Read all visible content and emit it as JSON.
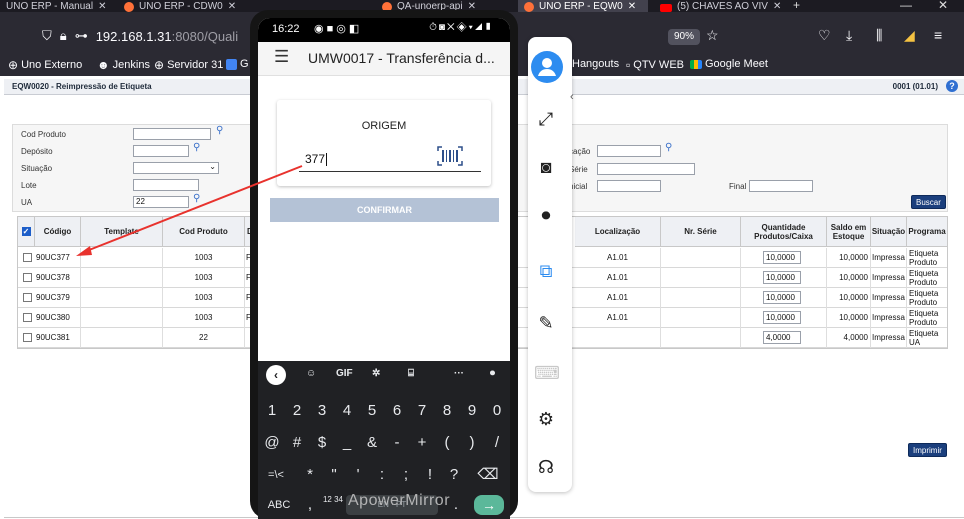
{
  "browser": {
    "tabs": [
      {
        "title": "UNO ERP - Manual ",
        "active": false
      },
      {
        "title": "UNO ERP - CDW0",
        "active": false
      },
      {
        "title": "QA-unoerp-api",
        "active": false
      },
      {
        "title": "UNO ERP - EQW0",
        "active": true
      },
      {
        "title": "(5) CHAVES AO VIV",
        "active": false
      }
    ],
    "url_host": "192.168.1.31",
    "url_rest": ":8080/Quali",
    "zoom": "90%",
    "bookmarks": [
      {
        "label": "Uno Externo",
        "icon": "globe-icon"
      },
      {
        "label": "Jenkins",
        "icon": "jenkins-icon"
      },
      {
        "label": "Servidor 31",
        "icon": "globe-icon"
      },
      {
        "label": "G",
        "icon": "calendar-icon"
      },
      {
        "label": "Hangouts",
        "icon": "hangouts-icon"
      },
      {
        "label": "QTV WEB",
        "icon": "qtv-icon"
      },
      {
        "label": "Google Meet",
        "icon": "meet-icon"
      }
    ]
  },
  "erp": {
    "title": "EQW0020 - Reimpressão de Etiqueta",
    "code": "0001 (01.01)",
    "help": "?",
    "filters": {
      "cod_produto": "Cod Produto",
      "deposito": "Depósito",
      "situacao": "Situação",
      "lote": "Lote",
      "ua": "UA",
      "ua_value": "22",
      "localizacao_partial": "cação",
      "serie_partial": "Série",
      "inicial_partial": "nicial",
      "final": "Final",
      "buscar": "Buscar"
    },
    "columns": {
      "codigo": "Código",
      "template": "Template",
      "cod_produto": "Cod Produto",
      "d_partial": "D",
      "localizacao": "Localização",
      "nr_serie": "Nr. Série",
      "quantidade": "Quantidade Produtos/Caixa",
      "saldo": "Saldo em Estoque",
      "situacao": "Situação",
      "programa": "Programa"
    },
    "rows": [
      {
        "codigo": "90UC377",
        "cod_produto": "1003",
        "d": "F",
        "localizacao": "A1.01",
        "quantidade": "10,0000",
        "saldo": "10,0000",
        "situacao": "Impressa",
        "programa": "Etiqueta Produto"
      },
      {
        "codigo": "90UC378",
        "cod_produto": "1003",
        "d": "F",
        "localizacao": "A1.01",
        "quantidade": "10,0000",
        "saldo": "10,0000",
        "situacao": "Impressa",
        "programa": "Etiqueta Produto"
      },
      {
        "codigo": "90UC379",
        "cod_produto": "1003",
        "d": "F",
        "localizacao": "A1.01",
        "quantidade": "10,0000",
        "saldo": "10,0000",
        "situacao": "Impressa",
        "programa": "Etiqueta Produto"
      },
      {
        "codigo": "90UC380",
        "cod_produto": "1003",
        "d": "F",
        "localizacao": "A1.01",
        "quantidade": "10,0000",
        "saldo": "10,0000",
        "situacao": "Impressa",
        "programa": "Etiqueta Produto"
      },
      {
        "codigo": "90UC381",
        "cod_produto": "22",
        "d": "",
        "localizacao": "",
        "quantidade": "4,0000",
        "saldo": "4,0000",
        "situacao": "Impressa",
        "programa": "Etiqueta UA"
      }
    ],
    "imprimir": "Imprimir"
  },
  "phone": {
    "time": "16:22",
    "app_title": "UMW0017 - Transferência d...",
    "card_title": "ORIGEM",
    "origin_value": "377",
    "confirm": "CONFIRMAR",
    "keyboard": {
      "gif": "GIF",
      "digits": [
        "1",
        "2",
        "3",
        "4",
        "5",
        "6",
        "7",
        "8",
        "9",
        "0"
      ],
      "symbols1": [
        "@",
        "#",
        "$",
        "_",
        "&",
        "-",
        "+",
        "(",
        ")",
        "/"
      ],
      "symbols2": [
        "=\\<",
        "*",
        "\"",
        "'",
        ":",
        ";",
        "!",
        "?"
      ],
      "abc": "ABC",
      "numpad": "12 34",
      "space": "EN · PT"
    },
    "watermark": "ApowerMirror"
  }
}
